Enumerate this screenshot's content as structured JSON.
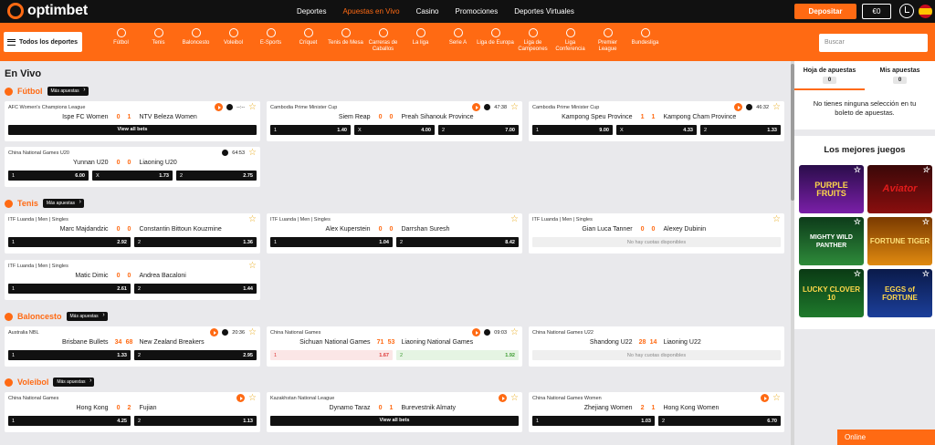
{
  "brand": {
    "name": "optimbet",
    "accent": "#ff6a13"
  },
  "topnav": [
    "Deportes",
    "Apuestas en Vivo",
    "Casino",
    "Promociones",
    "Deportes Virtuales"
  ],
  "header": {
    "deposit": "Depositar",
    "balance": "€0"
  },
  "all_sports": "Todos los deportes",
  "sports": [
    {
      "label": "Fútbol"
    },
    {
      "label": "Tenis"
    },
    {
      "label": "Baloncesto"
    },
    {
      "label": "Voleibol"
    },
    {
      "label": "E-Sports"
    },
    {
      "label": "Críquet"
    },
    {
      "label": "Tenis de Mesa"
    },
    {
      "label": "Carreras de Caballos"
    },
    {
      "label": "La liga"
    },
    {
      "label": "Serie A"
    },
    {
      "label": "Liga de Europa"
    },
    {
      "label": "Liga de Campeones"
    },
    {
      "label": "Liga Conferencia"
    },
    {
      "label": "Premier League"
    },
    {
      "label": "Bundesliga"
    }
  ],
  "search": {
    "placeholder": "Buscar"
  },
  "page_title": "En Vivo",
  "more_label": "Más apuestas",
  "sections": {
    "futbol": "Fútbol",
    "tenis": "Tenis",
    "baloncesto": "Baloncesto",
    "voleibol": "Voleibol"
  },
  "events": {
    "f1": {
      "league": "AFC Women's Champions League",
      "time": "--:--",
      "home": "Ispe FC Women",
      "hs": "0",
      "as": "1",
      "away": "NTV Beleza Women",
      "view_all": "View all bets"
    },
    "f2": {
      "league": "Cambodia Prime Minister Cup",
      "time": "47:38",
      "home": "Siem Reap",
      "hs": "0",
      "as": "0",
      "away": "Preah Sihanouk Province",
      "o1": "1.40",
      "ox": "4.00",
      "o2": "7.00"
    },
    "f3": {
      "league": "Cambodia Prime Minister Cup",
      "time": "46:32",
      "home": "Kampong Speu Province",
      "hs": "1",
      "as": "1",
      "away": "Kampong Cham Province",
      "o1": "9.00",
      "ox": "4.33",
      "o2": "1.33"
    },
    "f4": {
      "league": "China National Games U20",
      "time": "64:53",
      "home": "Yunnan U20",
      "hs": "0",
      "as": "0",
      "away": "Liaoning U20",
      "o1": "6.00",
      "ox": "1.73",
      "o2": "2.75"
    },
    "t1": {
      "league": "ITF Luanda | Men | Singles",
      "home": "Marc Majdandzic",
      "hs": "0",
      "as": "0",
      "away": "Constantin Bittoun Kouzmine",
      "o1": "2.92",
      "o2": "1.36"
    },
    "t2": {
      "league": "ITF Luanda | Men | Singles",
      "home": "Alex Kuperstein",
      "hs": "0",
      "as": "0",
      "away": "Darrshan Suresh",
      "o1": "1.04",
      "o2": "8.42"
    },
    "t3": {
      "league": "ITF Luanda | Men | Singles",
      "home": "Gian Luca Tanner",
      "hs": "0",
      "as": "0",
      "away": "Alexey Dubinin",
      "no_odds": "No hay cuotas disponibles"
    },
    "t4": {
      "league": "ITF Luanda | Men | Singles",
      "home": "Matic Dimic",
      "hs": "0",
      "as": "0",
      "away": "Andrea Bacaloni",
      "o1": "2.61",
      "o2": "1.44"
    },
    "b1": {
      "league": "Australia NBL",
      "time": "20:36",
      "home": "Brisbane Bullets",
      "hs": "34",
      "as": "68",
      "away": "New Zealand Breakers",
      "o1": "1.33",
      "o2": "2.95"
    },
    "b2": {
      "league": "China National Games",
      "time": "09:03",
      "home": "Sichuan National Games",
      "hs": "71",
      "as": "53",
      "away": "Liaoning National Games",
      "o1": "1.67",
      "o2": "1.92"
    },
    "b3": {
      "league": "China National Games U22",
      "home": "Shandong U22",
      "hs": "28",
      "as": "14",
      "away": "Liaoning U22",
      "no_odds": "No hay cuotas disponibles"
    },
    "v1": {
      "league": "China National Games",
      "home": "Hong Kong",
      "hs": "0",
      "as": "2",
      "away": "Fujian",
      "o1": "4.25",
      "o2": "1.13"
    },
    "v2": {
      "league": "Kazakhstan National League",
      "home": "Dynamo Taraz",
      "hs": "0",
      "as": "1",
      "away": "Burevestnik Almaty",
      "view_all": "View all bets"
    },
    "v3": {
      "league": "China National Games Women",
      "home": "Zhejiang Women",
      "hs": "2",
      "as": "1",
      "away": "Hong Kong Women",
      "o1": "1.03",
      "o2": "6.70"
    }
  },
  "odd_labels": {
    "one": "1",
    "x": "X",
    "two": "2"
  },
  "betslip": {
    "tab1": "Hoja de apuestas",
    "tab2": "Mis apuestas",
    "count1": "0",
    "count2": "0",
    "empty": "No tienes ninguna selección en tu boleto de apuestas."
  },
  "best_games": {
    "title": "Los mejores juegos",
    "games": [
      "PURPLE FRUITS",
      "Aviator",
      "MIGHTY WILD PANTHER",
      "FORTUNE TIGER",
      "LUCKY CLOVER 10",
      "EGGS of FORTUNE"
    ]
  },
  "online": "Online"
}
